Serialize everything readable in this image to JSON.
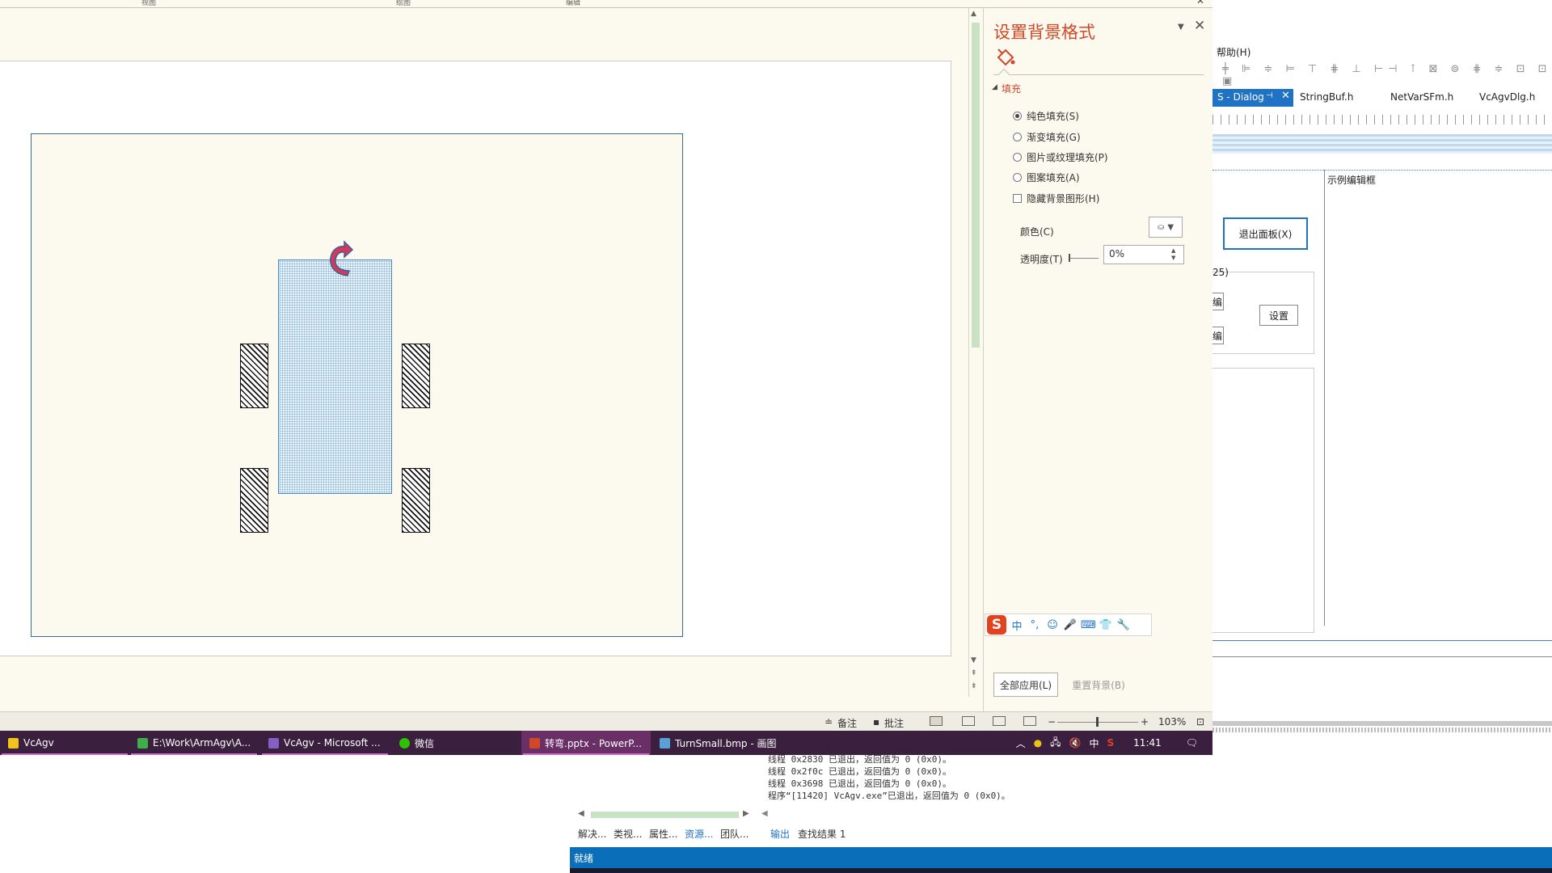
{
  "ribbon": {
    "frag1": "视图",
    "frag2": "绘图",
    "frag3": "编辑"
  },
  "format_pane": {
    "title": "设置背景格式",
    "section_fill": "填充",
    "options": [
      {
        "label": "纯色填充(S)",
        "selected": true
      },
      {
        "label": "渐变填充(G)",
        "selected": false
      },
      {
        "label": "图片或纹理填充(P)",
        "selected": false
      },
      {
        "label": "图案填充(A)",
        "selected": false
      }
    ],
    "hide_bg_graphics": "隐藏背景图形(H)",
    "color_label": "颜色(C)",
    "transparency_label": "透明度(T)",
    "transparency_value": "0%",
    "apply_all": "全部应用(L)",
    "reset_bg": "重置背景(B)"
  },
  "ime_bar": {
    "items": [
      "中",
      "°,",
      "☺",
      "🎤",
      "⌨",
      "👕",
      "🔧"
    ]
  },
  "ppt_status": {
    "notes": "备注",
    "comments": "批注",
    "zoom": "103%"
  },
  "taskbar": {
    "items": [
      {
        "label": "VcAgv",
        "color": "#f0c419"
      },
      {
        "label": "E:\\Work\\ArmAgv\\A...",
        "color": "#3fae49"
      },
      {
        "label": "VcAgv - Microsoft ...",
        "color": "#865fc5"
      },
      {
        "label": "微信",
        "color": "#2dc100"
      },
      {
        "label": "转弯.pptx - PowerP...",
        "color": "#d24726"
      },
      {
        "label": "TurnSmall.bmp - 画图",
        "color": "#5aa0d8"
      }
    ],
    "tray_ime": "中",
    "time": "11:41"
  },
  "vs": {
    "help_menu": "帮助(H)",
    "tabs": {
      "active": "S - Dialog",
      "t2": "StringBuf.h",
      "t3": "NetVarSFm.h",
      "t4": "VcAgvDlg.h"
    },
    "edit_label": "示例编辑框",
    "exit_panel_button": "退出面板(X)",
    "group_label_frag": "25)",
    "edit_frag": "编",
    "set_button": "设置"
  },
  "output": {
    "lines": [
      "线程 0x2830 已退出，返回值为 0 (0x0)。",
      "线程 0x2f0c 已退出，返回值为 0 (0x0)。",
      "线程 0x3698 已退出，返回值为 0 (0x0)。",
      "程序“[11420] VcAgv.exe”已退出，返回值为 0 (0x0)。"
    ],
    "tabs": [
      "解决...",
      "类视...",
      "属性...",
      "资源...",
      "团队...",
      "输出",
      "查找结果 1"
    ],
    "status": "就绪"
  },
  "colors": {
    "accent": "#d24726",
    "taskbar": "#3b1f3f",
    "vs_blue": "#1f72c4",
    "slide_bg": "#fcf9ef"
  }
}
